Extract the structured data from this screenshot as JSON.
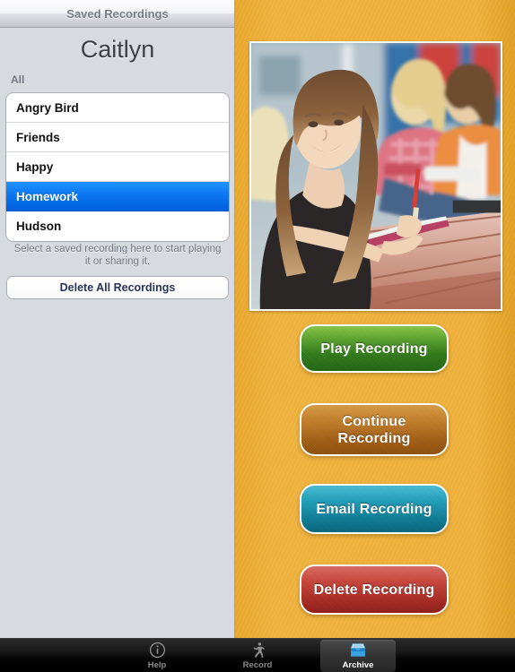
{
  "sidebar": {
    "topbar_title": "Saved Recordings",
    "user_name": "Caitlyn",
    "section_header": "All",
    "recordings": [
      {
        "label": "Angry Bird",
        "selected": false
      },
      {
        "label": "Friends",
        "selected": false
      },
      {
        "label": "Happy",
        "selected": false
      },
      {
        "label": "Homework",
        "selected": true
      },
      {
        "label": "Hudson",
        "selected": false
      }
    ],
    "hint_text": "Select a saved recording here to start playing it or sharing it.",
    "delete_all_label": "Delete All Recordings"
  },
  "panel": {
    "photo_alt": "Smiling teenage girl writing in a notebook at an outdoor picnic table with friends in the background",
    "buttons": [
      {
        "label": "Play Recording",
        "color": "#2f7a18",
        "name": "play-recording-button"
      },
      {
        "label": "Continue Recording",
        "color": "#a45f13",
        "name": "continue-recording-button"
      },
      {
        "label": "Email Recording",
        "color": "#0b7c95",
        "name": "email-recording-button"
      },
      {
        "label": "Delete Recording",
        "color": "#a92a22",
        "name": "delete-recording-button"
      }
    ],
    "background_color": "#eeb03a"
  },
  "tabbar": {
    "tabs": [
      {
        "label": "Help",
        "icon": "info-circle-icon",
        "selected": false
      },
      {
        "label": "Record",
        "icon": "running-person-icon",
        "selected": false
      },
      {
        "label": "Archive",
        "icon": "archive-tray-icon",
        "selected": true
      }
    ]
  }
}
